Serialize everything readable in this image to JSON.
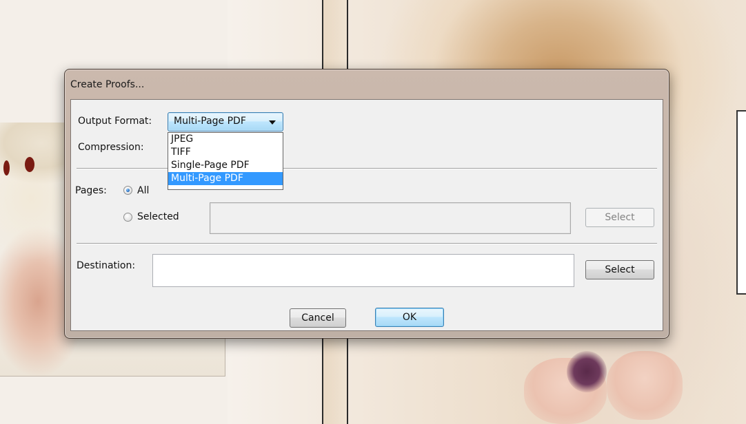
{
  "dialog": {
    "title": "Create Proofs...",
    "output_format": {
      "label": "Output Format:",
      "selected": "Multi-Page PDF",
      "options": [
        "JPEG",
        "TIFF",
        "Single-Page PDF",
        "Multi-Page PDF"
      ]
    },
    "compression": {
      "label": "Compression:"
    },
    "pages": {
      "label": "Pages:",
      "all_label": "All",
      "selected_label": "Selected",
      "select_button": "Select",
      "selected_field_value": ""
    },
    "destination": {
      "label": "Destination:",
      "value": "",
      "select_button": "Select"
    },
    "cancel_label": "Cancel",
    "ok_label": "OK"
  },
  "colors": {
    "dialog_frame": "#c4b4a8",
    "dialog_body": "#f0f0f0",
    "highlight": "#3399ff",
    "focus_border": "#3c7fb1"
  }
}
